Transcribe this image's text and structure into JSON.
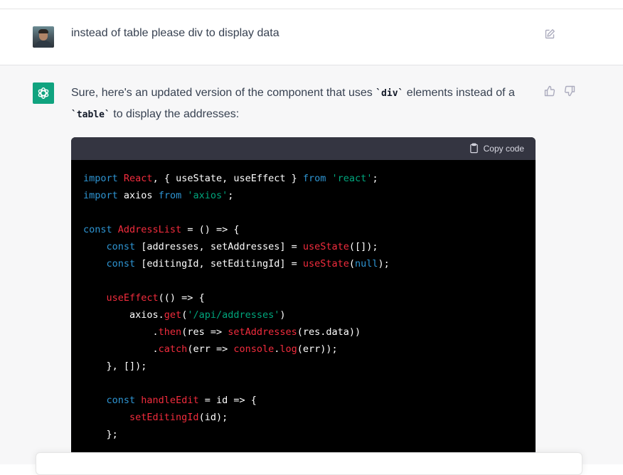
{
  "user_message": {
    "text": "instead of table please div to display data"
  },
  "assistant_message": {
    "intro_part1": "Sure, here's an updated version of the component that uses ",
    "code1": "`div`",
    "intro_part2": " elements instead of a ",
    "code2": "`table`",
    "intro_part3": " to display the addresses:"
  },
  "code_block": {
    "copy_label": "Copy code",
    "lines": [
      [
        {
          "t": "kw",
          "v": "import"
        },
        {
          "t": "p",
          "v": " "
        },
        {
          "t": "fn",
          "v": "React"
        },
        {
          "t": "p",
          "v": ", { useState, useEffect } "
        },
        {
          "t": "kw",
          "v": "from"
        },
        {
          "t": "p",
          "v": " "
        },
        {
          "t": "str",
          "v": "'react'"
        },
        {
          "t": "p",
          "v": ";"
        }
      ],
      [
        {
          "t": "kw",
          "v": "import"
        },
        {
          "t": "p",
          "v": " axios "
        },
        {
          "t": "kw",
          "v": "from"
        },
        {
          "t": "p",
          "v": " "
        },
        {
          "t": "str",
          "v": "'axios'"
        },
        {
          "t": "p",
          "v": ";"
        }
      ],
      [],
      [
        {
          "t": "kw",
          "v": "const"
        },
        {
          "t": "p",
          "v": " "
        },
        {
          "t": "fn",
          "v": "AddressList"
        },
        {
          "t": "p",
          "v": " = () => {"
        }
      ],
      [
        {
          "t": "p",
          "v": "    "
        },
        {
          "t": "kw",
          "v": "const"
        },
        {
          "t": "p",
          "v": " [addresses, setAddresses] = "
        },
        {
          "t": "fn",
          "v": "useState"
        },
        {
          "t": "p",
          "v": "([]);"
        }
      ],
      [
        {
          "t": "p",
          "v": "    "
        },
        {
          "t": "kw",
          "v": "const"
        },
        {
          "t": "p",
          "v": " [editingId, setEditingId] = "
        },
        {
          "t": "fn",
          "v": "useState"
        },
        {
          "t": "p",
          "v": "("
        },
        {
          "t": "kw",
          "v": "null"
        },
        {
          "t": "p",
          "v": ");"
        }
      ],
      [],
      [
        {
          "t": "p",
          "v": "    "
        },
        {
          "t": "fn",
          "v": "useEffect"
        },
        {
          "t": "p",
          "v": "(() => {"
        }
      ],
      [
        {
          "t": "p",
          "v": "        axios."
        },
        {
          "t": "fn",
          "v": "get"
        },
        {
          "t": "p",
          "v": "("
        },
        {
          "t": "str",
          "v": "'/api/addresses'"
        },
        {
          "t": "p",
          "v": ")"
        }
      ],
      [
        {
          "t": "p",
          "v": "            ."
        },
        {
          "t": "fn",
          "v": "then"
        },
        {
          "t": "p",
          "v": "(res => "
        },
        {
          "t": "fn",
          "v": "setAddresses"
        },
        {
          "t": "p",
          "v": "(res.data))"
        }
      ],
      [
        {
          "t": "p",
          "v": "            ."
        },
        {
          "t": "fn",
          "v": "catch"
        },
        {
          "t": "p",
          "v": "(err => "
        },
        {
          "t": "fn",
          "v": "console"
        },
        {
          "t": "p",
          "v": "."
        },
        {
          "t": "fn",
          "v": "log"
        },
        {
          "t": "p",
          "v": "(err));"
        }
      ],
      [
        {
          "t": "p",
          "v": "    }, []);"
        }
      ],
      [],
      [
        {
          "t": "p",
          "v": "    "
        },
        {
          "t": "kw",
          "v": "const"
        },
        {
          "t": "p",
          "v": " "
        },
        {
          "t": "fn",
          "v": "handleEdit"
        },
        {
          "t": "p",
          "v": " = id => {"
        }
      ],
      [
        {
          "t": "p",
          "v": "        "
        },
        {
          "t": "fn",
          "v": "setEditingId"
        },
        {
          "t": "p",
          "v": "(id);"
        }
      ],
      [
        {
          "t": "p",
          "v": "    };"
        }
      ]
    ]
  },
  "colors": {
    "keyword": "#2e95d3",
    "string": "#00a67d",
    "function": "#f22c3d",
    "brand": "#10a37f"
  }
}
